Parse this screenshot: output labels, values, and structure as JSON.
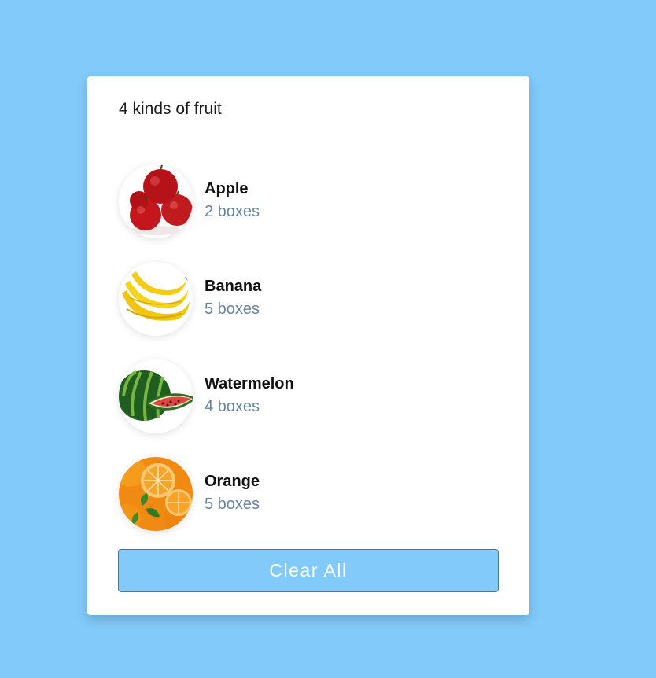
{
  "header": {
    "title": "4 kinds of fruit"
  },
  "fruits": [
    {
      "name": "Apple",
      "count": "2 boxes",
      "icon": "apple-icon"
    },
    {
      "name": "Banana",
      "count": "5 boxes",
      "icon": "banana-icon"
    },
    {
      "name": "Watermelon",
      "count": "4 boxes",
      "icon": "watermelon-icon"
    },
    {
      "name": "Orange",
      "count": "5 boxes",
      "icon": "orange-icon"
    }
  ],
  "actions": {
    "clear_label": "Clear All"
  },
  "colors": {
    "background": "#82cafa",
    "card": "#ffffff",
    "count_text": "#6783a0",
    "button": "#82cafa"
  }
}
